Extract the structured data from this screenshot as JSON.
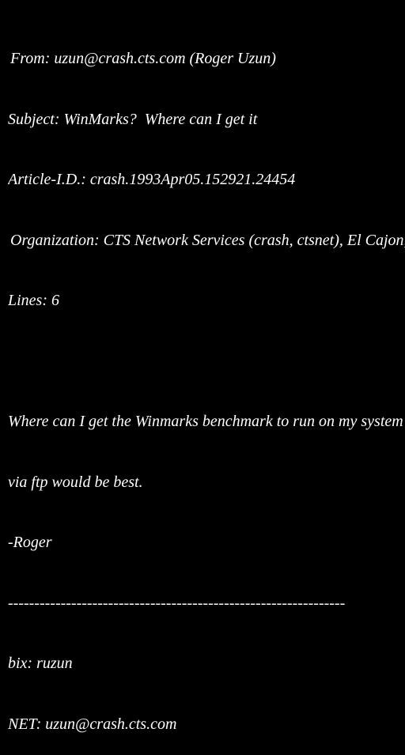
{
  "colors": {
    "background": "#000000",
    "text": "#ffffff"
  },
  "header": {
    "from": "From: uzun@crash.cts.com (Roger Uzun)",
    "subject": "Subject: WinMarks?  Where can I get it",
    "article_id": "Article-I.D.: crash.1993Apr05.152921.24454",
    "organization": "Organization: CTS Network Services (crash, ctsnet), El Cajon, CA",
    "lines": "Lines: 6"
  },
  "body": {
    "line1": "Where can I get the Winmarks benchmark to run on my system?",
    "line2": "via ftp would be best.",
    "line3": "-Roger"
  },
  "signature": {
    "divider": "----------------------------------------------------------------",
    "bix": "bix: ruzun",
    "net": "NET: uzun@crash.cts.com"
  }
}
